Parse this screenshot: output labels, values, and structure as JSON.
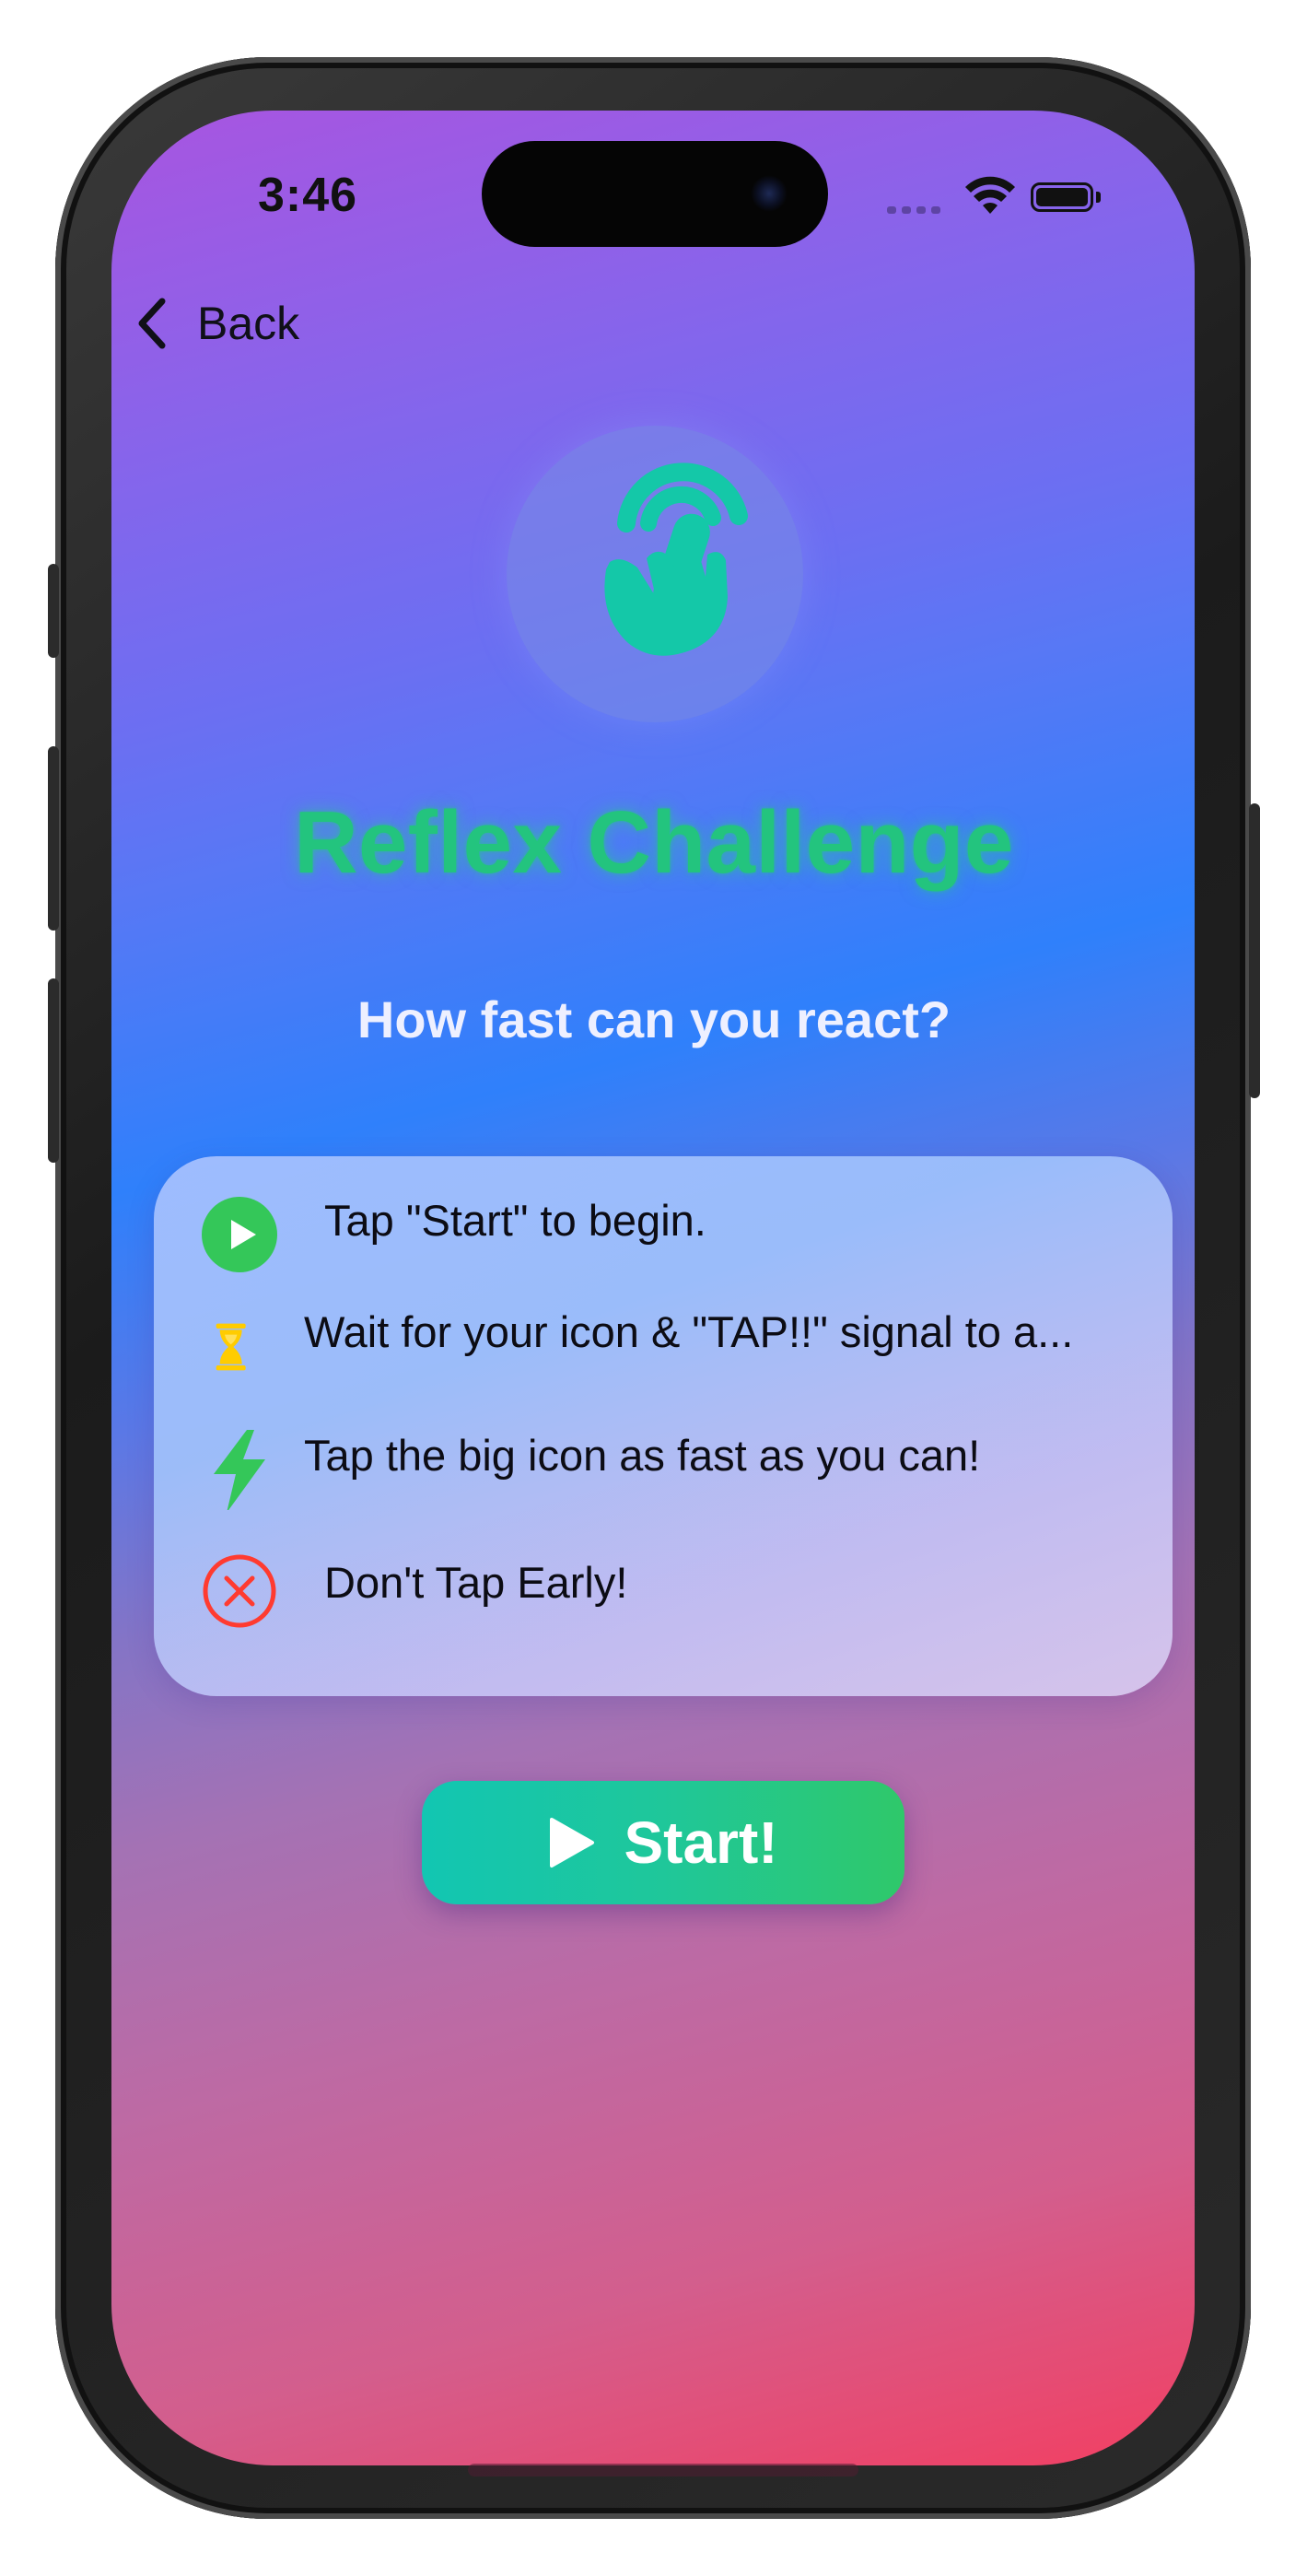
{
  "status_bar": {
    "time": "3:46"
  },
  "nav": {
    "back_label": "Back"
  },
  "hero": {
    "icon": "hand-tap-icon",
    "title": "Reflex Challenge",
    "subtitle": "How fast can you react?"
  },
  "rules": [
    {
      "icon": "play-circle-icon",
      "text": "Tap \"Start\" to begin."
    },
    {
      "icon": "hourglass-icon",
      "text": "Wait for your icon & \"TAP!!\" signal to a..."
    },
    {
      "icon": "lightning-bolt-icon",
      "text": "Tap the big icon as fast as you can!"
    },
    {
      "icon": "x-circle-icon",
      "text": "Don't Tap Early!"
    }
  ],
  "start_button": {
    "icon": "play-icon",
    "label": "Start!"
  },
  "colors": {
    "title_green": "#23c47e",
    "play_green": "#34c759",
    "hourglass_yellow": "#ffcc00",
    "x_red": "#ff3b30",
    "button_gradient_start": "#12c6b2",
    "button_gradient_end": "#2fc86a"
  }
}
